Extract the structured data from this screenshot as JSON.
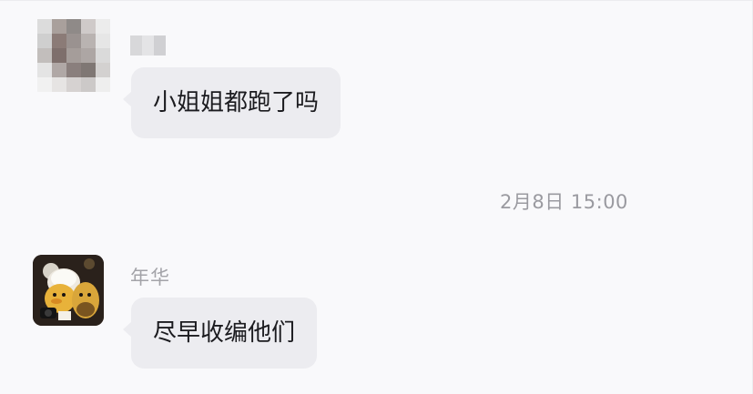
{
  "messages": [
    {
      "sender_name": "",
      "text": "小姐姐都跑了吗",
      "avatar_icon": "pixelated-avatar"
    },
    {
      "sender_name": "年华",
      "text": "尽早收编他们",
      "avatar_icon": "photo-avatar"
    }
  ],
  "timestamp": "2月8日 15:00",
  "colors": {
    "bubble_bg": "#ececf0",
    "page_bg": "#f9f9fb",
    "sender_text": "#a3a3a8",
    "timestamp_text": "#9a9aa0"
  }
}
